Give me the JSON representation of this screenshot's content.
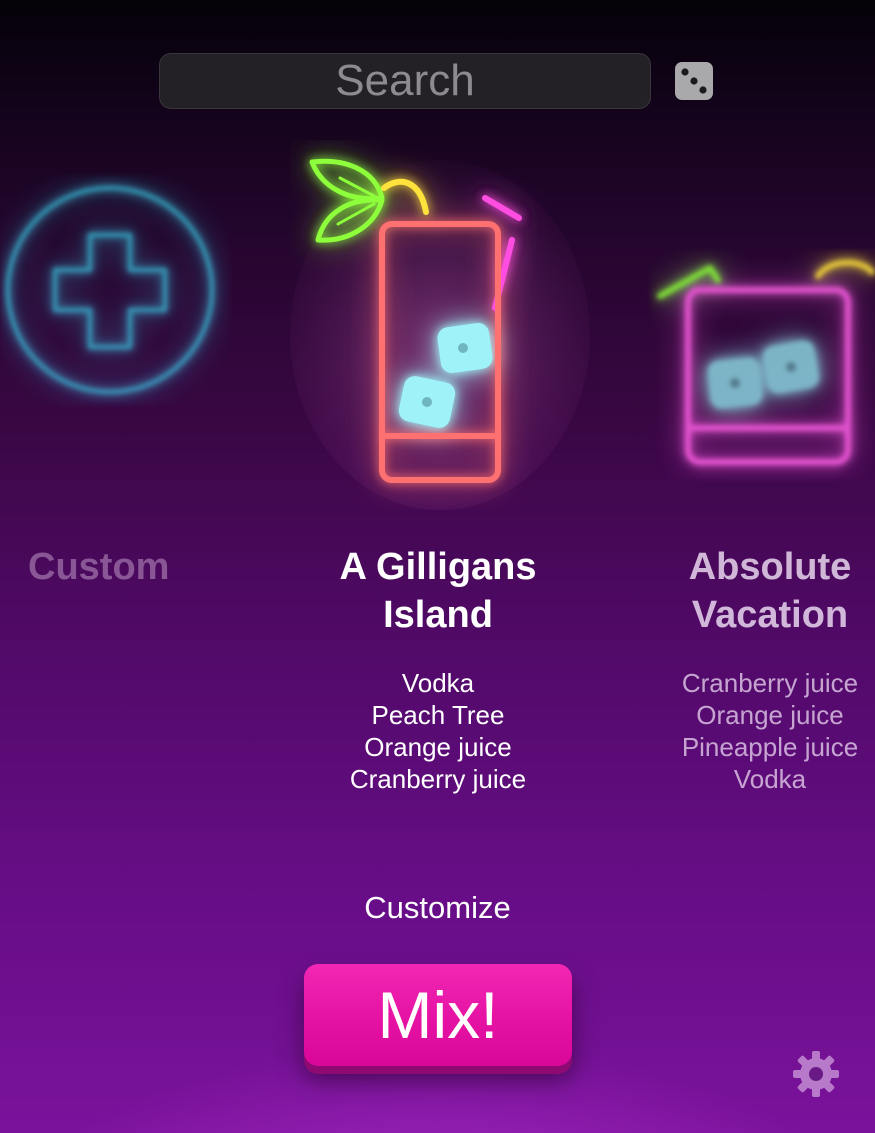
{
  "search": {
    "placeholder": "Search",
    "value": ""
  },
  "header": {
    "random_icon": "dice-icon"
  },
  "carousel": [
    {
      "title": "Custom",
      "icon": "add-circle-icon",
      "ingredients": []
    },
    {
      "title_line1": "A Gilligans",
      "title_line2": "Island",
      "icon": "tall-cocktail-glass-icon",
      "ingredients": [
        "Vodka",
        "Peach Tree",
        "Orange juice",
        "Cranberry juice"
      ]
    },
    {
      "title_line1": "Absolute",
      "title_line2": "Vacation",
      "icon": "rocks-glass-icon",
      "ingredients": [
        "Cranberry juice",
        "Orange juice",
        "Pineapple juice",
        "Vodka"
      ]
    }
  ],
  "actions": {
    "customize_label": "Customize",
    "mix_label": "Mix!"
  },
  "footer": {
    "settings_icon": "gear-icon"
  },
  "colors": {
    "neon_cyan": "#3ee6ff",
    "neon_coral": "#ff6f6f",
    "neon_magenta": "#ff4de1",
    "neon_green": "#8dff3a",
    "neon_yellow": "#ffe23a",
    "ice_blue": "#9ff3f8",
    "mix_button": "#e512a3"
  }
}
